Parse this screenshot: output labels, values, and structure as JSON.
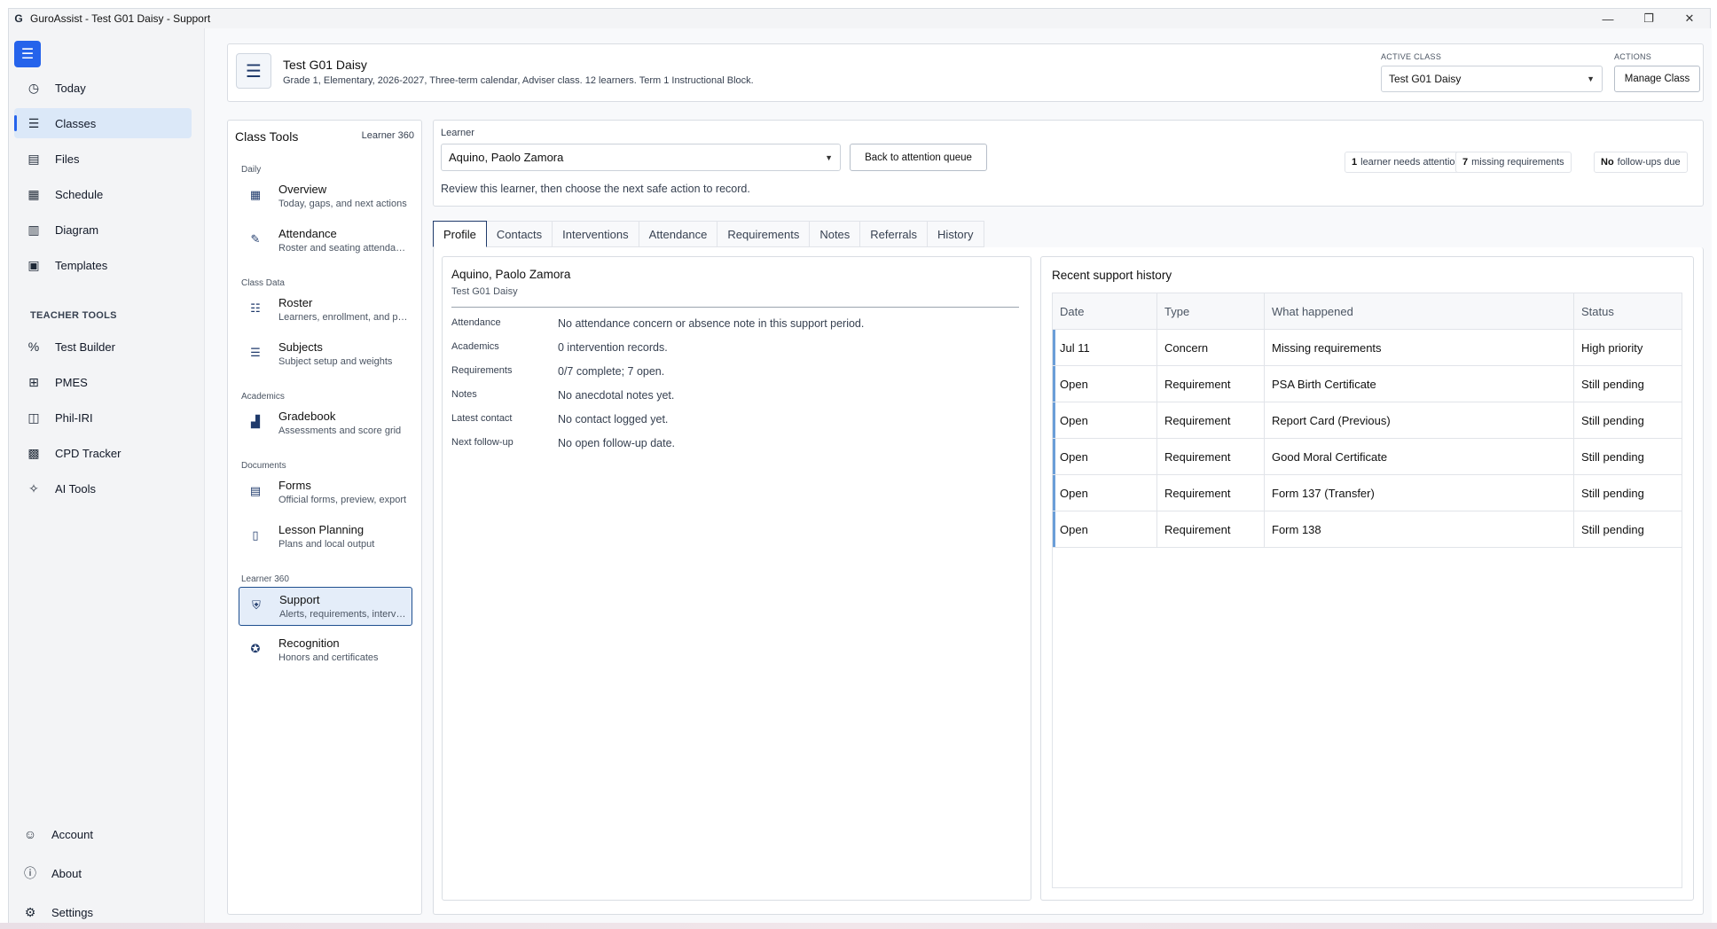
{
  "window": {
    "title": "GuroAssist - Test G01 Daisy - Support",
    "app_icon": "G",
    "controls": {
      "minimize": "—",
      "maximize": "❐",
      "close": "✕"
    }
  },
  "nav": {
    "items": [
      {
        "label": "Today",
        "icon": "clock-icon"
      },
      {
        "label": "Classes",
        "icon": "list-icon",
        "active": true
      },
      {
        "label": "Files",
        "icon": "file-icon"
      },
      {
        "label": "Schedule",
        "icon": "calendar-icon"
      },
      {
        "label": "Diagram",
        "icon": "diagram-icon"
      },
      {
        "label": "Templates",
        "icon": "template-icon"
      }
    ],
    "section_teacher": "TEACHER TOOLS",
    "teacher_items": [
      {
        "label": "Test Builder",
        "icon": "percent-icon"
      },
      {
        "label": "PMES",
        "icon": "pmes-icon"
      },
      {
        "label": "Phil-IRI",
        "icon": "book-icon"
      },
      {
        "label": "CPD Tracker",
        "icon": "tracker-icon"
      },
      {
        "label": "AI Tools",
        "icon": "wand-icon"
      }
    ],
    "bottom_items": [
      {
        "label": "Account",
        "icon": "account-icon"
      },
      {
        "label": "About",
        "icon": "info-icon"
      },
      {
        "label": "Settings",
        "icon": "gear-icon"
      }
    ]
  },
  "header": {
    "class_name": "Test G01 Daisy",
    "class_details": "Grade 1, Elementary, 2026-2027, Three-term calendar, Adviser class. 12 learners. Term 1 Instructional Block.",
    "active_class_label": "ACTIVE CLASS",
    "active_class_value": "Test G01 Daisy",
    "actions_label": "ACTIONS",
    "manage_button": "Manage Class"
  },
  "class_tools": {
    "title": "Class Tools",
    "right_label": "Learner 360",
    "groups": {
      "daily": "Daily",
      "class_data": "Class Data",
      "academics": "Academics",
      "documents": "Documents",
      "learner360": "Learner 360"
    },
    "items": {
      "overview": {
        "name": "Overview",
        "desc": "Today, gaps, and next actions"
      },
      "attendance": {
        "name": "Attendance",
        "desc": "Roster and seating attendance"
      },
      "roster": {
        "name": "Roster",
        "desc": "Learners, enrollment, and profiles"
      },
      "subjects": {
        "name": "Subjects",
        "desc": "Subject setup and weights"
      },
      "gradebook": {
        "name": "Gradebook",
        "desc": "Assessments and score grid"
      },
      "forms": {
        "name": "Forms",
        "desc": "Official forms, preview, export"
      },
      "lesson": {
        "name": "Lesson Planning",
        "desc": "Plans and local output"
      },
      "support": {
        "name": "Support",
        "desc": "Alerts, requirements, interventions"
      },
      "recognition": {
        "name": "Recognition",
        "desc": "Honors and certificates"
      }
    }
  },
  "learner_bar": {
    "label": "Learner",
    "selected": "Aquino, Paolo Zamora",
    "back_button": "Back to attention queue",
    "hint": "Review this learner, then choose the next safe action to record.",
    "stats": [
      {
        "num": "1",
        "text": "learner needs attention"
      },
      {
        "num": "7",
        "text": "missing requirements"
      },
      {
        "num": "No",
        "text": "follow-ups due"
      }
    ]
  },
  "tabs": [
    "Profile",
    "Contacts",
    "Interventions",
    "Attendance",
    "Requirements",
    "Notes",
    "Referrals",
    "History"
  ],
  "profile": {
    "name": "Aquino, Paolo Zamora",
    "class": "Test G01 Daisy",
    "rows": [
      {
        "key": "Attendance",
        "value": "No attendance concern or absence note in this support period."
      },
      {
        "key": "Academics",
        "value": "0 intervention records."
      },
      {
        "key": "Requirements",
        "value": "0/7 complete; 7 open."
      },
      {
        "key": "Notes",
        "value": "No anecdotal notes yet."
      },
      {
        "key": "Latest contact",
        "value": "No contact logged yet."
      },
      {
        "key": "Next follow-up",
        "value": "No open follow-up date."
      }
    ]
  },
  "history": {
    "title": "Recent support history",
    "columns": [
      "Date",
      "Type",
      "What happened",
      "Status"
    ],
    "rows": [
      [
        "Jul 11",
        "Concern",
        "Missing requirements",
        "High priority"
      ],
      [
        "Open",
        "Requirement",
        "PSA Birth Certificate",
        "Still pending"
      ],
      [
        "Open",
        "Requirement",
        "Report Card (Previous)",
        "Still pending"
      ],
      [
        "Open",
        "Requirement",
        "Good Moral Certificate",
        "Still pending"
      ],
      [
        "Open",
        "Requirement",
        "Form 137 (Transfer)",
        "Still pending"
      ],
      [
        "Open",
        "Requirement",
        "Form 138",
        "Still pending"
      ]
    ]
  },
  "colors": {
    "accent": "#2563eb",
    "active_nav": "#dbe8f8",
    "border": "#d9dde3"
  }
}
